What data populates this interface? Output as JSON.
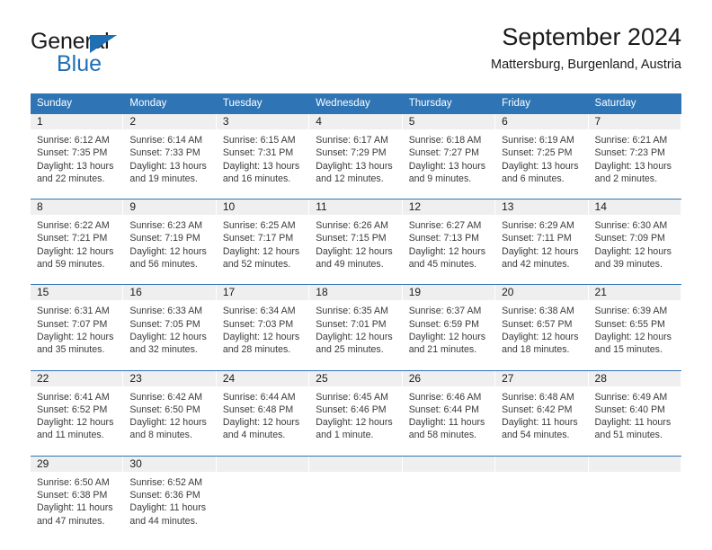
{
  "brand": {
    "name_part1": "General",
    "name_part2": "Blue",
    "accent_color": "#1f6fb5",
    "triangle_icon": "triangle-icon"
  },
  "header": {
    "title": "September 2024",
    "subtitle": "Mattersburg, Burgenland, Austria"
  },
  "calendar": {
    "header_bg": "#2f75b5",
    "daynum_bg": "#efefef",
    "weekday_headers": [
      "Sunday",
      "Monday",
      "Tuesday",
      "Wednesday",
      "Thursday",
      "Friday",
      "Saturday"
    ],
    "weeks": [
      [
        {
          "day": "1",
          "sunrise": "Sunrise: 6:12 AM",
          "sunset": "Sunset: 7:35 PM",
          "daylight_line1": "Daylight: 13 hours",
          "daylight_line2": "and 22 minutes."
        },
        {
          "day": "2",
          "sunrise": "Sunrise: 6:14 AM",
          "sunset": "Sunset: 7:33 PM",
          "daylight_line1": "Daylight: 13 hours",
          "daylight_line2": "and 19 minutes."
        },
        {
          "day": "3",
          "sunrise": "Sunrise: 6:15 AM",
          "sunset": "Sunset: 7:31 PM",
          "daylight_line1": "Daylight: 13 hours",
          "daylight_line2": "and 16 minutes."
        },
        {
          "day": "4",
          "sunrise": "Sunrise: 6:17 AM",
          "sunset": "Sunset: 7:29 PM",
          "daylight_line1": "Daylight: 13 hours",
          "daylight_line2": "and 12 minutes."
        },
        {
          "day": "5",
          "sunrise": "Sunrise: 6:18 AM",
          "sunset": "Sunset: 7:27 PM",
          "daylight_line1": "Daylight: 13 hours",
          "daylight_line2": "and 9 minutes."
        },
        {
          "day": "6",
          "sunrise": "Sunrise: 6:19 AM",
          "sunset": "Sunset: 7:25 PM",
          "daylight_line1": "Daylight: 13 hours",
          "daylight_line2": "and 6 minutes."
        },
        {
          "day": "7",
          "sunrise": "Sunrise: 6:21 AM",
          "sunset": "Sunset: 7:23 PM",
          "daylight_line1": "Daylight: 13 hours",
          "daylight_line2": "and 2 minutes."
        }
      ],
      [
        {
          "day": "8",
          "sunrise": "Sunrise: 6:22 AM",
          "sunset": "Sunset: 7:21 PM",
          "daylight_line1": "Daylight: 12 hours",
          "daylight_line2": "and 59 minutes."
        },
        {
          "day": "9",
          "sunrise": "Sunrise: 6:23 AM",
          "sunset": "Sunset: 7:19 PM",
          "daylight_line1": "Daylight: 12 hours",
          "daylight_line2": "and 56 minutes."
        },
        {
          "day": "10",
          "sunrise": "Sunrise: 6:25 AM",
          "sunset": "Sunset: 7:17 PM",
          "daylight_line1": "Daylight: 12 hours",
          "daylight_line2": "and 52 minutes."
        },
        {
          "day": "11",
          "sunrise": "Sunrise: 6:26 AM",
          "sunset": "Sunset: 7:15 PM",
          "daylight_line1": "Daylight: 12 hours",
          "daylight_line2": "and 49 minutes."
        },
        {
          "day": "12",
          "sunrise": "Sunrise: 6:27 AM",
          "sunset": "Sunset: 7:13 PM",
          "daylight_line1": "Daylight: 12 hours",
          "daylight_line2": "and 45 minutes."
        },
        {
          "day": "13",
          "sunrise": "Sunrise: 6:29 AM",
          "sunset": "Sunset: 7:11 PM",
          "daylight_line1": "Daylight: 12 hours",
          "daylight_line2": "and 42 minutes."
        },
        {
          "day": "14",
          "sunrise": "Sunrise: 6:30 AM",
          "sunset": "Sunset: 7:09 PM",
          "daylight_line1": "Daylight: 12 hours",
          "daylight_line2": "and 39 minutes."
        }
      ],
      [
        {
          "day": "15",
          "sunrise": "Sunrise: 6:31 AM",
          "sunset": "Sunset: 7:07 PM",
          "daylight_line1": "Daylight: 12 hours",
          "daylight_line2": "and 35 minutes."
        },
        {
          "day": "16",
          "sunrise": "Sunrise: 6:33 AM",
          "sunset": "Sunset: 7:05 PM",
          "daylight_line1": "Daylight: 12 hours",
          "daylight_line2": "and 32 minutes."
        },
        {
          "day": "17",
          "sunrise": "Sunrise: 6:34 AM",
          "sunset": "Sunset: 7:03 PM",
          "daylight_line1": "Daylight: 12 hours",
          "daylight_line2": "and 28 minutes."
        },
        {
          "day": "18",
          "sunrise": "Sunrise: 6:35 AM",
          "sunset": "Sunset: 7:01 PM",
          "daylight_line1": "Daylight: 12 hours",
          "daylight_line2": "and 25 minutes."
        },
        {
          "day": "19",
          "sunrise": "Sunrise: 6:37 AM",
          "sunset": "Sunset: 6:59 PM",
          "daylight_line1": "Daylight: 12 hours",
          "daylight_line2": "and 21 minutes."
        },
        {
          "day": "20",
          "sunrise": "Sunrise: 6:38 AM",
          "sunset": "Sunset: 6:57 PM",
          "daylight_line1": "Daylight: 12 hours",
          "daylight_line2": "and 18 minutes."
        },
        {
          "day": "21",
          "sunrise": "Sunrise: 6:39 AM",
          "sunset": "Sunset: 6:55 PM",
          "daylight_line1": "Daylight: 12 hours",
          "daylight_line2": "and 15 minutes."
        }
      ],
      [
        {
          "day": "22",
          "sunrise": "Sunrise: 6:41 AM",
          "sunset": "Sunset: 6:52 PM",
          "daylight_line1": "Daylight: 12 hours",
          "daylight_line2": "and 11 minutes."
        },
        {
          "day": "23",
          "sunrise": "Sunrise: 6:42 AM",
          "sunset": "Sunset: 6:50 PM",
          "daylight_line1": "Daylight: 12 hours",
          "daylight_line2": "and 8 minutes."
        },
        {
          "day": "24",
          "sunrise": "Sunrise: 6:44 AM",
          "sunset": "Sunset: 6:48 PM",
          "daylight_line1": "Daylight: 12 hours",
          "daylight_line2": "and 4 minutes."
        },
        {
          "day": "25",
          "sunrise": "Sunrise: 6:45 AM",
          "sunset": "Sunset: 6:46 PM",
          "daylight_line1": "Daylight: 12 hours",
          "daylight_line2": "and 1 minute."
        },
        {
          "day": "26",
          "sunrise": "Sunrise: 6:46 AM",
          "sunset": "Sunset: 6:44 PM",
          "daylight_line1": "Daylight: 11 hours",
          "daylight_line2": "and 58 minutes."
        },
        {
          "day": "27",
          "sunrise": "Sunrise: 6:48 AM",
          "sunset": "Sunset: 6:42 PM",
          "daylight_line1": "Daylight: 11 hours",
          "daylight_line2": "and 54 minutes."
        },
        {
          "day": "28",
          "sunrise": "Sunrise: 6:49 AM",
          "sunset": "Sunset: 6:40 PM",
          "daylight_line1": "Daylight: 11 hours",
          "daylight_line2": "and 51 minutes."
        }
      ],
      [
        {
          "day": "29",
          "sunrise": "Sunrise: 6:50 AM",
          "sunset": "Sunset: 6:38 PM",
          "daylight_line1": "Daylight: 11 hours",
          "daylight_line2": "and 47 minutes."
        },
        {
          "day": "30",
          "sunrise": "Sunrise: 6:52 AM",
          "sunset": "Sunset: 6:36 PM",
          "daylight_line1": "Daylight: 11 hours",
          "daylight_line2": "and 44 minutes."
        },
        {
          "day": "",
          "sunrise": "",
          "sunset": "",
          "daylight_line1": "",
          "daylight_line2": ""
        },
        {
          "day": "",
          "sunrise": "",
          "sunset": "",
          "daylight_line1": "",
          "daylight_line2": ""
        },
        {
          "day": "",
          "sunrise": "",
          "sunset": "",
          "daylight_line1": "",
          "daylight_line2": ""
        },
        {
          "day": "",
          "sunrise": "",
          "sunset": "",
          "daylight_line1": "",
          "daylight_line2": ""
        },
        {
          "day": "",
          "sunrise": "",
          "sunset": "",
          "daylight_line1": "",
          "daylight_line2": ""
        }
      ]
    ]
  }
}
